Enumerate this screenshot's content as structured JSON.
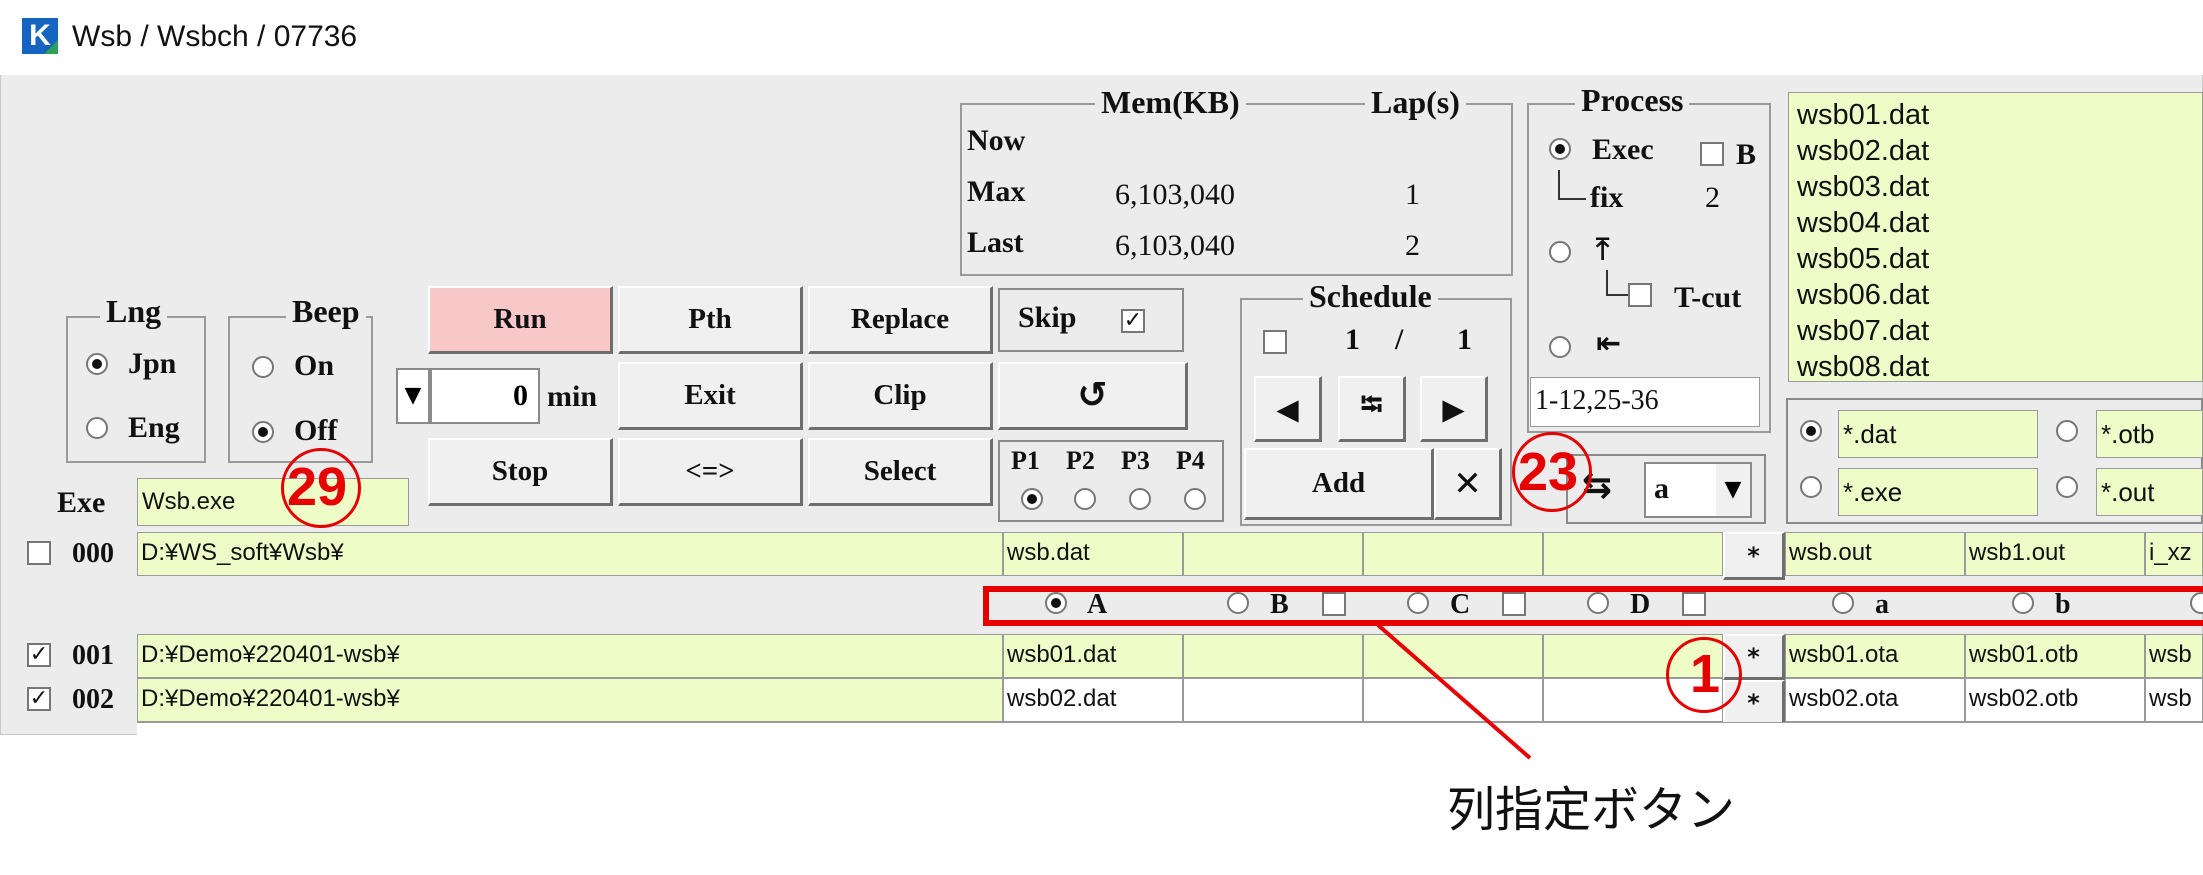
{
  "window": {
    "title": "Wsb / Wsbch / 07736"
  },
  "mem_group": {
    "mem_header": "Mem(KB)",
    "lap_header": "Lap(s)",
    "rows": [
      {
        "label": "Now",
        "mem": "",
        "lap": ""
      },
      {
        "label": "Max",
        "mem": "6,103,040",
        "lap": "1"
      },
      {
        "label": "Last",
        "mem": "6,103,040",
        "lap": "2"
      }
    ]
  },
  "process": {
    "title": "Process",
    "exec_label": "Exec",
    "b_label": "B",
    "fix_label": "fix",
    "fix_value": "2",
    "up_label": "⤒",
    "tcut_label": "T-cut",
    "back_label": "⇤",
    "range_value": "1-12,25-36"
  },
  "file_list": [
    "wsb01.dat",
    "wsb02.dat",
    "wsb03.dat",
    "wsb04.dat",
    "wsb05.dat",
    "wsb06.dat",
    "wsb07.dat",
    "wsb08.dat"
  ],
  "lng": {
    "title": "Lng",
    "opt1": "Jpn",
    "opt2": "Eng"
  },
  "beep": {
    "title": "Beep",
    "opt1": "On",
    "opt2": "Off"
  },
  "buttons": {
    "run": "Run",
    "pth": "Pth",
    "replace": "Replace",
    "exit": "Exit",
    "clip": "Clip",
    "refresh": "↺",
    "stop": "Stop",
    "swap": "<=>",
    "select": "Select",
    "add": "Add",
    "delete": "✕"
  },
  "timer": {
    "value": "0",
    "unit": "min"
  },
  "skip": {
    "label": "Skip",
    "checked": "✓"
  },
  "priority": {
    "p1": "P1",
    "p2": "P2",
    "p3": "P3",
    "p4": "P4"
  },
  "schedule": {
    "title": "Schedule",
    "current": "1",
    "sep": "/",
    "total": "1",
    "prev": "◀",
    "mid": "⭾",
    "next": "▶"
  },
  "direction": {
    "arrow": "⇆",
    "select_value": "a"
  },
  "ext_filters": {
    "dat": "*.dat",
    "otb": "*.otb",
    "exe": "*.exe",
    "out": "*.out"
  },
  "exe": {
    "label": "Exe",
    "value": "Wsb.exe"
  },
  "row000": {
    "num": "000",
    "path": "D:¥WS_soft¥Wsb¥",
    "c1": "wsb.dat",
    "star": "*",
    "o1": "wsb.out",
    "o2": "wsb1.out",
    "o3": "i_xz"
  },
  "col_radios": {
    "A": "A",
    "B": "B",
    "C": "C",
    "D": "D",
    "a": "a",
    "b": "b"
  },
  "rows": [
    {
      "num": "001",
      "path": "D:¥Demo¥220401-wsb¥",
      "c1": "wsb01.dat",
      "star": "*",
      "o1": "wsb01.ota",
      "o2": "wsb01.otb",
      "o3": "wsb"
    },
    {
      "num": "002",
      "path": "D:¥Demo¥220401-wsb¥",
      "c1": "wsb02.dat",
      "star": "*",
      "o1": "wsb02.ota",
      "o2": "wsb02.otb",
      "o3": "wsb"
    }
  ],
  "annotations": {
    "n29": "29",
    "n23": "23",
    "n1": "1",
    "caption": "列指定ボタン"
  },
  "colors": {
    "field_bg": "#eefcc8",
    "run_bg": "#f8c8c8",
    "annotation": "#e60000"
  }
}
